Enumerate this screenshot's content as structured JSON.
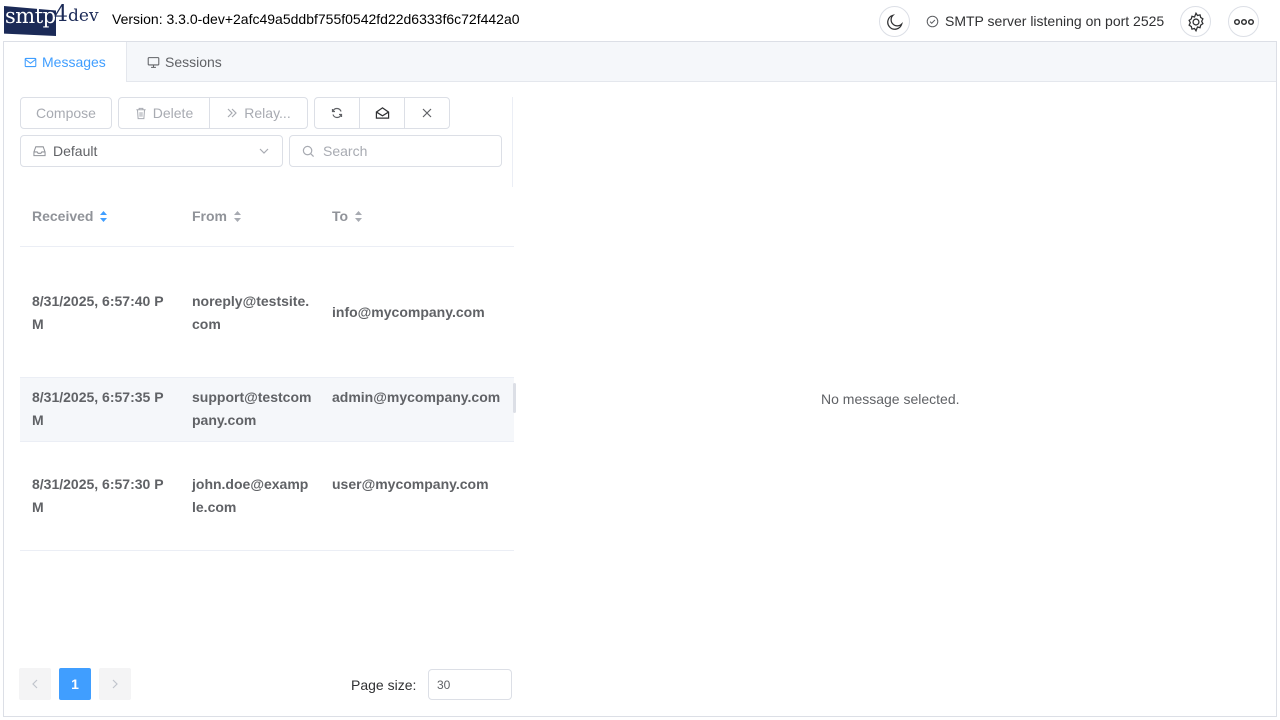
{
  "app": {
    "logo_main": "smtp",
    "logo_four": "4",
    "logo_dev": "dev",
    "version": "Version: 3.3.0-dev+2afc49a5ddbf755f0542fd22d6333f6c72f442a0",
    "status": "SMTP server listening on port 2525"
  },
  "tabs": [
    {
      "label": "Messages",
      "icon": "mail-icon",
      "active": true
    },
    {
      "label": "Sessions",
      "icon": "monitor-icon",
      "active": false
    }
  ],
  "toolbar": {
    "compose": "Compose",
    "delete": "Delete",
    "relay": "Relay..."
  },
  "mailbox": {
    "selected": "Default"
  },
  "search": {
    "placeholder": "Search"
  },
  "table": {
    "headers": {
      "received": "Received",
      "from": "From",
      "to": "To"
    },
    "rows": [
      {
        "received": "8/31/2025, 6:57:40 PM",
        "from": "noreply@testsite.com",
        "to": "info@mycompany.com"
      },
      {
        "received": "8/31/2025, 6:57:35 PM",
        "from": "support@testcompany.com",
        "to": "admin@mycompany.com"
      },
      {
        "received": "8/31/2025, 6:57:30 PM",
        "from": "john.doe@example.com",
        "to": "user@mycompany.com"
      }
    ]
  },
  "pagination": {
    "current_page": "1",
    "page_size_label": "Page size:",
    "page_size": "30"
  },
  "viewer": {
    "empty_text": "No message selected."
  },
  "colors": {
    "accent": "#409eff",
    "logo": "#1b2a57"
  }
}
